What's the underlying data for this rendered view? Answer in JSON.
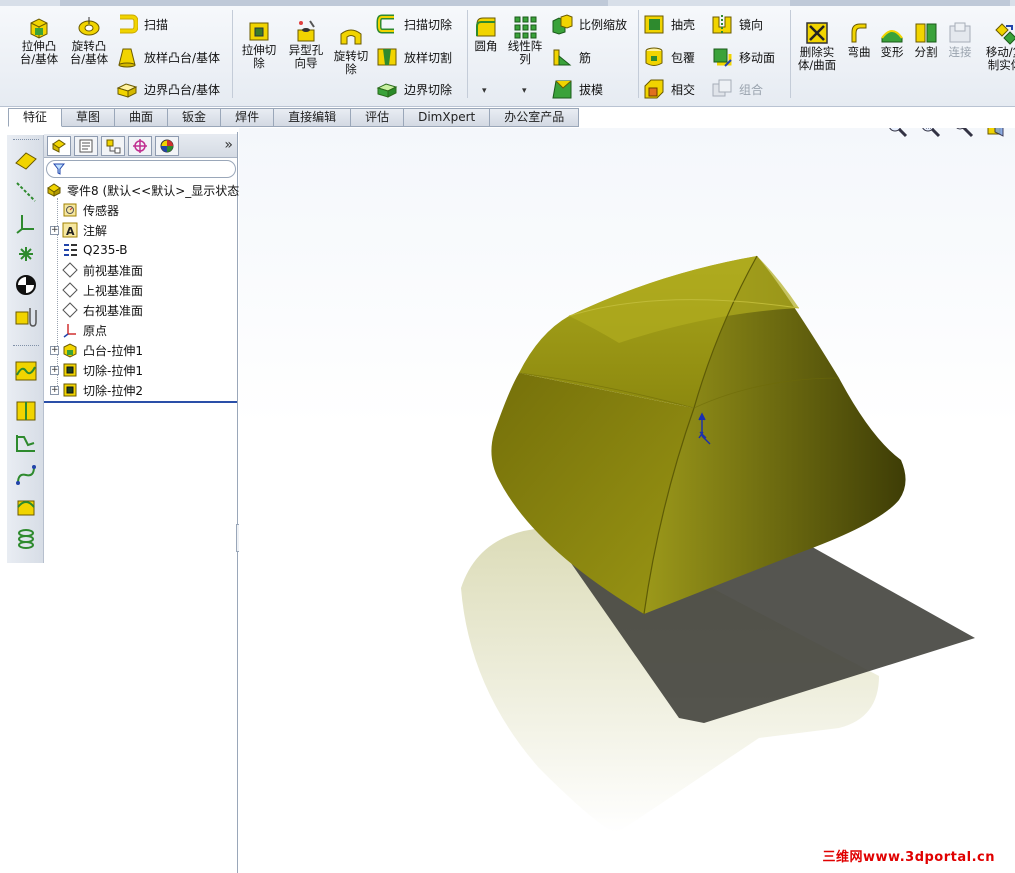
{
  "ribbon": {
    "extrude_boss": "拉伸凸\n台/基体",
    "revolve_boss": "旋转凸\n台/基体",
    "sweep": "扫描",
    "loft": "放样凸台/基体",
    "boundary_boss": "边界凸台/基体",
    "extrude_cut": "拉伸切\n除",
    "hole_wizard": "异型孔\n向导",
    "revolve_cut": "旋转切\n除",
    "swept_cut": "扫描切除",
    "lofted_cut": "放样切割",
    "boundary_cut": "边界切除",
    "fillet": "圆角",
    "linear_pattern": "线性阵\n列",
    "scale": "比例缩放",
    "rib": "筋",
    "draft": "拔模",
    "shell": "抽壳",
    "wrap": "包覆",
    "intersect": "相交",
    "mirror": "镜向",
    "move_face": "移动面",
    "combine": "组合",
    "delete_body": "删除实\n体/曲面",
    "flex": "弯曲",
    "deform": "变形",
    "split": "分割",
    "join": "连接",
    "move_copy": "移动/复\n制实体"
  },
  "tabs": [
    "特征",
    "草图",
    "曲面",
    "钣金",
    "焊件",
    "直接编辑",
    "评估",
    "DimXpert",
    "办公室产品"
  ],
  "feature_tree": {
    "root": "零件8  (默认<<默认>_显示状态",
    "items": [
      {
        "label": "传感器",
        "icon": "sensor-icon",
        "expandable": false
      },
      {
        "label": "注解",
        "icon": "annotation-icon",
        "expandable": true
      },
      {
        "label": "Q235-B",
        "icon": "material-icon",
        "expandable": false
      },
      {
        "label": "前视基准面",
        "icon": "plane-icon",
        "expandable": false
      },
      {
        "label": "上视基准面",
        "icon": "plane-icon",
        "expandable": false
      },
      {
        "label": "右视基准面",
        "icon": "plane-icon",
        "expandable": false
      },
      {
        "label": "原点",
        "icon": "origin-icon",
        "expandable": false
      },
      {
        "label": "凸台-拉伸1",
        "icon": "boss-extrude-icon",
        "expandable": true
      },
      {
        "label": "切除-拉伸1",
        "icon": "cut-extrude-icon",
        "expandable": true
      },
      {
        "label": "切除-拉伸2",
        "icon": "cut-extrude-icon",
        "expandable": true
      }
    ]
  },
  "panel": {
    "more": "»",
    "filter_placeholder": ""
  },
  "watermark": "三维网www.3dportal.cn",
  "colors": {
    "accent_yellow": "#e8c400",
    "model": "#8c8a10",
    "rollback": "#2a4fa8"
  }
}
